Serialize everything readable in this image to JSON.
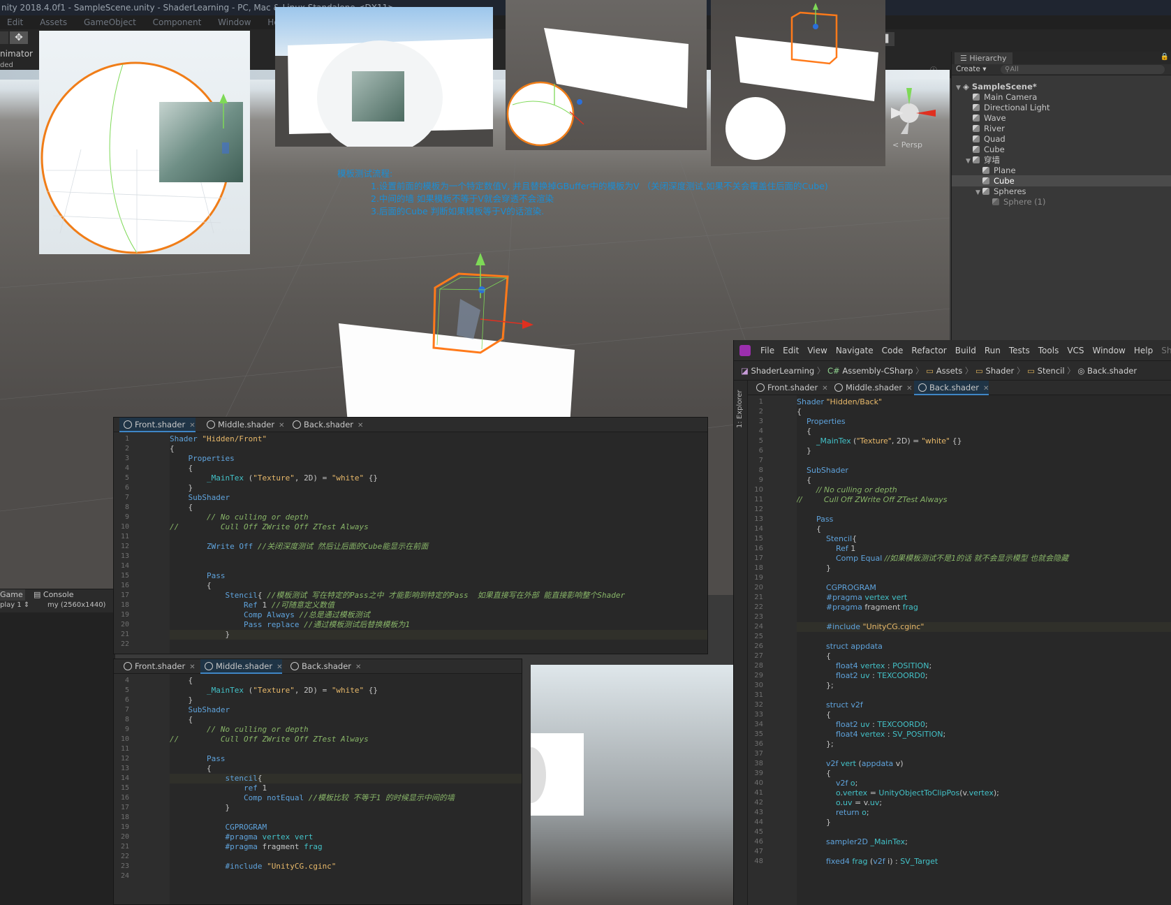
{
  "unity": {
    "title": "nity 2018.4.0f1 - SampleScene.unity - ShaderLearning - PC, Mac & Linux Standalone <DX11>",
    "menu": [
      "Edit",
      "Assets",
      "GameObject",
      "Component",
      "Window",
      "Help"
    ],
    "animator_label": "nimator",
    "loaded_label": "ded",
    "persp_label": "Persp",
    "game_tab": "Game",
    "console_tab": "Console",
    "display_label": "play 1",
    "resolution_label": "my (2560x1440)"
  },
  "hierarchy": {
    "tab": "Hierarchy",
    "create": "Create",
    "search_placeholder": "All",
    "scene": "SampleScene*",
    "items": [
      {
        "label": "Main Camera"
      },
      {
        "label": "Directional Light"
      },
      {
        "label": "Wave"
      },
      {
        "label": "River"
      },
      {
        "label": "Quad"
      },
      {
        "label": "Cube"
      },
      {
        "label": "穿墙"
      },
      {
        "label": "Plane"
      },
      {
        "label": "Cube"
      },
      {
        "label": "Spheres"
      },
      {
        "label": "Sphere (1)"
      }
    ]
  },
  "notes": {
    "title": "模板测试流程:",
    "l1": "1.设置前面的模板为一个特定数值V, 并且替换掉GBuffer中的模板为V （关闭深度测试,如果不关会覆盖住后面的Cube)",
    "l2": "2.中间的墙 如果模板不等于V就会穿透不会渲染",
    "l3": "3.后面的Cube 判断如果模板等于V的话渲染."
  },
  "ide": {
    "menu": [
      "File",
      "Edit",
      "View",
      "Navigate",
      "Code",
      "Refactor",
      "Build",
      "Run",
      "Tests",
      "Tools",
      "VCS",
      "Window",
      "Help",
      "Shade"
    ],
    "breadcrumb": [
      "ShaderLearning",
      "Assembly-CSharp",
      "Assets",
      "Shader",
      "Stencil",
      "Back.shader"
    ],
    "explorer_label": "1: Explorer"
  },
  "tabs": {
    "front": "Front.shader",
    "middle": "Middle.shader",
    "back": "Back.shader"
  },
  "front_lines": [
    "Shader \"Hidden/Front\"",
    "{",
    "    Properties",
    "    {",
    "        _MainTex (\"Texture\", 2D) = \"white\" {}",
    "    }",
    "    SubShader",
    "    {",
    "        // No culling or depth",
    "//         Cull Off ZWrite Off ZTest Always",
    "",
    "        ZWrite Off //关闭深度测试 然后让后面的Cube能显示在前面",
    "",
    "",
    "        Pass",
    "        {",
    "            Stencil{ //模板测试 写在特定的Pass之中 才能影响到特定的Pass  如果直接写在外部 能直接影响整个Shader",
    "                Ref 1 //可随意定义数值",
    "                Comp Always //总是通过模板测试",
    "                Pass replace //通过模板测试后替换模板为1",
    "            }",
    ""
  ],
  "middle_lines": [
    "    {",
    "        _MainTex (\"Texture\", 2D) = \"white\" {}",
    "    }",
    "    SubShader",
    "    {",
    "        // No culling or depth",
    "//         Cull Off ZWrite Off ZTest Always",
    "",
    "        Pass",
    "        {",
    "            stencil{",
    "                ref 1",
    "                Comp notEqual //模板比较 不等于1 的时候显示中间的墙",
    "            }",
    "",
    "            CGPROGRAM",
    "            #pragma vertex vert",
    "            #pragma fragment frag",
    "",
    "            #include \"UnityCG.cginc\"",
    ""
  ],
  "back_lines": [
    "Shader \"Hidden/Back\"",
    "{",
    "    Properties",
    "    {",
    "        _MainTex (\"Texture\", 2D) = \"white\" {}",
    "    }",
    "",
    "    SubShader",
    "    {",
    "        // No culling or depth",
    "//         Cull Off ZWrite Off ZTest Always",
    "",
    "        Pass",
    "        {",
    "            Stencil{",
    "                Ref 1",
    "                Comp Equal //如果模板测试不是1的话 就不会显示模型 也就会隐藏",
    "            }",
    "",
    "            CGPROGRAM",
    "            #pragma vertex vert",
    "            #pragma fragment frag",
    "",
    "            #include \"UnityCG.cginc\"",
    "",
    "            struct appdata",
    "            {",
    "                float4 vertex : POSITION;",
    "                float2 uv : TEXCOORD0;",
    "            };",
    "",
    "            struct v2f",
    "            {",
    "                float2 uv : TEXCOORD0;",
    "                float4 vertex : SV_POSITION;",
    "            };",
    "",
    "            v2f vert (appdata v)",
    "            {",
    "                v2f o;",
    "                o.vertex = UnityObjectToClipPos(v.vertex);",
    "                o.uv = v.uv;",
    "                return o;",
    "            }",
    "",
    "            sampler2D _MainTex;",
    "",
    "            fixed4 frag (v2f i) : SV_Target"
  ],
  "colors": {
    "selection": "#ff7a1a",
    "note_text": "#1a8ed6",
    "keyword": "#5fa3dc",
    "string": "#e8b96a",
    "comment": "#88b568",
    "active_tab": "#1f3446"
  }
}
